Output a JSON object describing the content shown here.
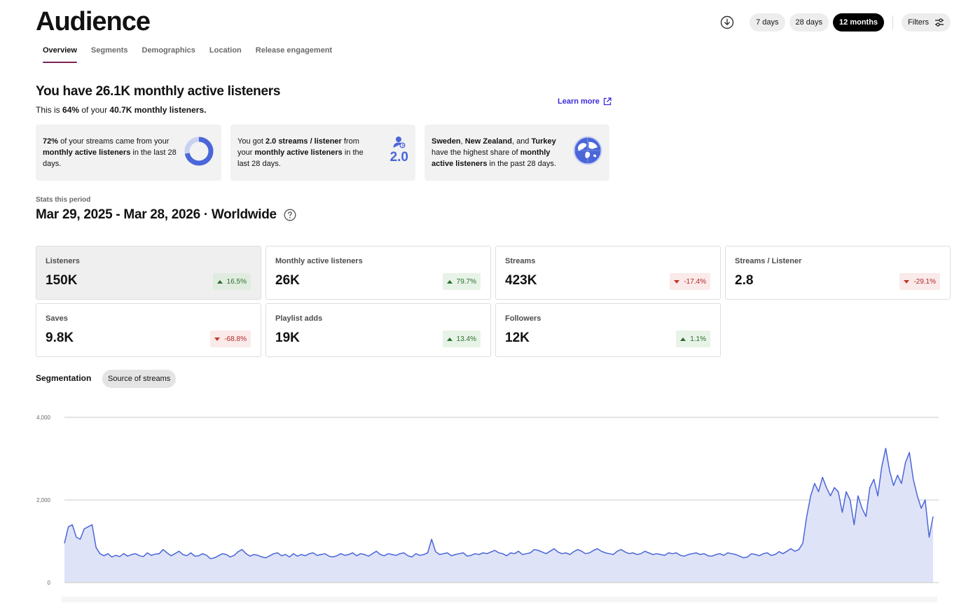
{
  "header": {
    "title": "Audience",
    "tabs": [
      {
        "label": "Overview",
        "active": true
      },
      {
        "label": "Segments",
        "active": false
      },
      {
        "label": "Demographics",
        "active": false
      },
      {
        "label": "Location",
        "active": false
      },
      {
        "label": "Release engagement",
        "active": false
      }
    ],
    "ranges": [
      {
        "label": "7 days",
        "active": false
      },
      {
        "label": "28 days",
        "active": false
      },
      {
        "label": "12 months",
        "active": true
      }
    ],
    "filters_label": "Filters"
  },
  "summary": {
    "heading": "You have 26.1K monthly active listeners",
    "sub_prefix": "This is ",
    "sub_percent": "64%",
    "sub_middle": " of your ",
    "sub_total": "40.7K monthly listeners.",
    "learn_more": "Learn more"
  },
  "insights": [
    {
      "bold1": "72%",
      "text1": " of your streams came from your ",
      "bold2": "monthly active listeners",
      "text2": " in the last 28 days.",
      "donut_fraction": 0.72
    },
    {
      "text0": "You got ",
      "bold1": "2.0 streams / listener",
      "text1": " from your ",
      "bold2": "monthly active listeners",
      "text2": " in the last 28 days.",
      "ratio": "2.0"
    },
    {
      "bold1": "Sweden",
      "text1": ", ",
      "bold2": "New Zealand",
      "text2": ", and ",
      "bold3": "Turkey",
      "text3": " have the highest share of ",
      "bold4": "monthly active listeners",
      "text4": " in the past 28 days."
    }
  ],
  "period": {
    "label": "Stats this period",
    "value": "Mar 29, 2025 - Mar 28, 2026 · Worldwide"
  },
  "stats": [
    {
      "label": "Listeners",
      "value": "150K",
      "change": "16.5%",
      "direction": "up",
      "selected": true
    },
    {
      "label": "Monthly active listeners",
      "value": "26K",
      "change": "79.7%",
      "direction": "up",
      "selected": false
    },
    {
      "label": "Streams",
      "value": "423K",
      "change": "-17.4%",
      "direction": "down",
      "selected": false
    },
    {
      "label": "Streams / Listener",
      "value": "2.8",
      "change": "-29.1%",
      "direction": "down",
      "selected": false
    },
    {
      "label": "Saves",
      "value": "9.8K",
      "change": "-68.8%",
      "direction": "down",
      "selected": false
    },
    {
      "label": "Playlist adds",
      "value": "19K",
      "change": "13.4%",
      "direction": "up",
      "selected": false
    },
    {
      "label": "Followers",
      "value": "12K",
      "change": "1.1%",
      "direction": "up",
      "selected": false
    }
  ],
  "segmentation": {
    "label": "Segmentation",
    "pill": "Source of streams"
  },
  "colors": {
    "accent_tab": "#7e2456",
    "link": "#3b2bd9",
    "series_line": "#4a66d8",
    "series_fill": "#dfe3f7",
    "up": "#2b6e2b",
    "down": "#b12828"
  },
  "chart_data": {
    "type": "area",
    "y_ticks": [
      "4,000",
      "2,000",
      "0"
    ],
    "ylim": [
      0,
      4000
    ],
    "grid": true,
    "series": [
      {
        "values": [
          950,
          1350,
          1400,
          1100,
          1050,
          1300,
          1350,
          1400,
          850,
          700,
          650,
          700,
          620,
          660,
          630,
          700,
          640,
          680,
          700,
          650,
          630,
          720,
          660,
          690,
          700,
          800,
          720,
          650,
          700,
          760,
          680,
          650,
          720,
          640,
          650,
          700,
          660,
          580,
          600,
          650,
          700,
          680,
          620,
          660,
          750,
          800,
          700,
          640,
          680,
          660,
          620,
          600,
          650,
          700,
          720,
          650,
          680,
          620,
          700,
          640,
          680,
          650,
          700,
          720,
          660,
          680,
          700,
          640,
          620,
          650,
          700,
          660,
          680,
          720,
          650,
          700,
          680,
          640,
          700,
          760,
          680,
          650,
          700,
          680,
          660,
          700,
          720,
          650,
          620,
          700,
          660,
          680,
          720,
          1050,
          750,
          680,
          700,
          720,
          650,
          680,
          700,
          720,
          640,
          660,
          700,
          680,
          720,
          700,
          740,
          780,
          720,
          700,
          650,
          720,
          700,
          760,
          680,
          700,
          720,
          800,
          780,
          740,
          700,
          760,
          820,
          740,
          700,
          720,
          680,
          750,
          800,
          760,
          700,
          720,
          780,
          820,
          760,
          720,
          700,
          680,
          760,
          800,
          740,
          700,
          720,
          680,
          700,
          760,
          720,
          680,
          700,
          680,
          660,
          720,
          700,
          720,
          660,
          640,
          680,
          700,
          720,
          680,
          700,
          650,
          640,
          680,
          700,
          660,
          720,
          700,
          680,
          640,
          600,
          620,
          700,
          680,
          650,
          700,
          720,
          660,
          680,
          750,
          700,
          760,
          820,
          760,
          800,
          950,
          1600,
          2100,
          2400,
          2200,
          2550,
          2300,
          2100,
          2300,
          2200,
          1700,
          2200,
          2000,
          1400,
          2100,
          1800,
          1600,
          2300,
          2500,
          2100,
          2800,
          3250,
          2700,
          2350,
          2600,
          2400,
          2900,
          3150,
          2500,
          2100,
          1800,
          2000,
          1100,
          1600
        ]
      }
    ]
  }
}
